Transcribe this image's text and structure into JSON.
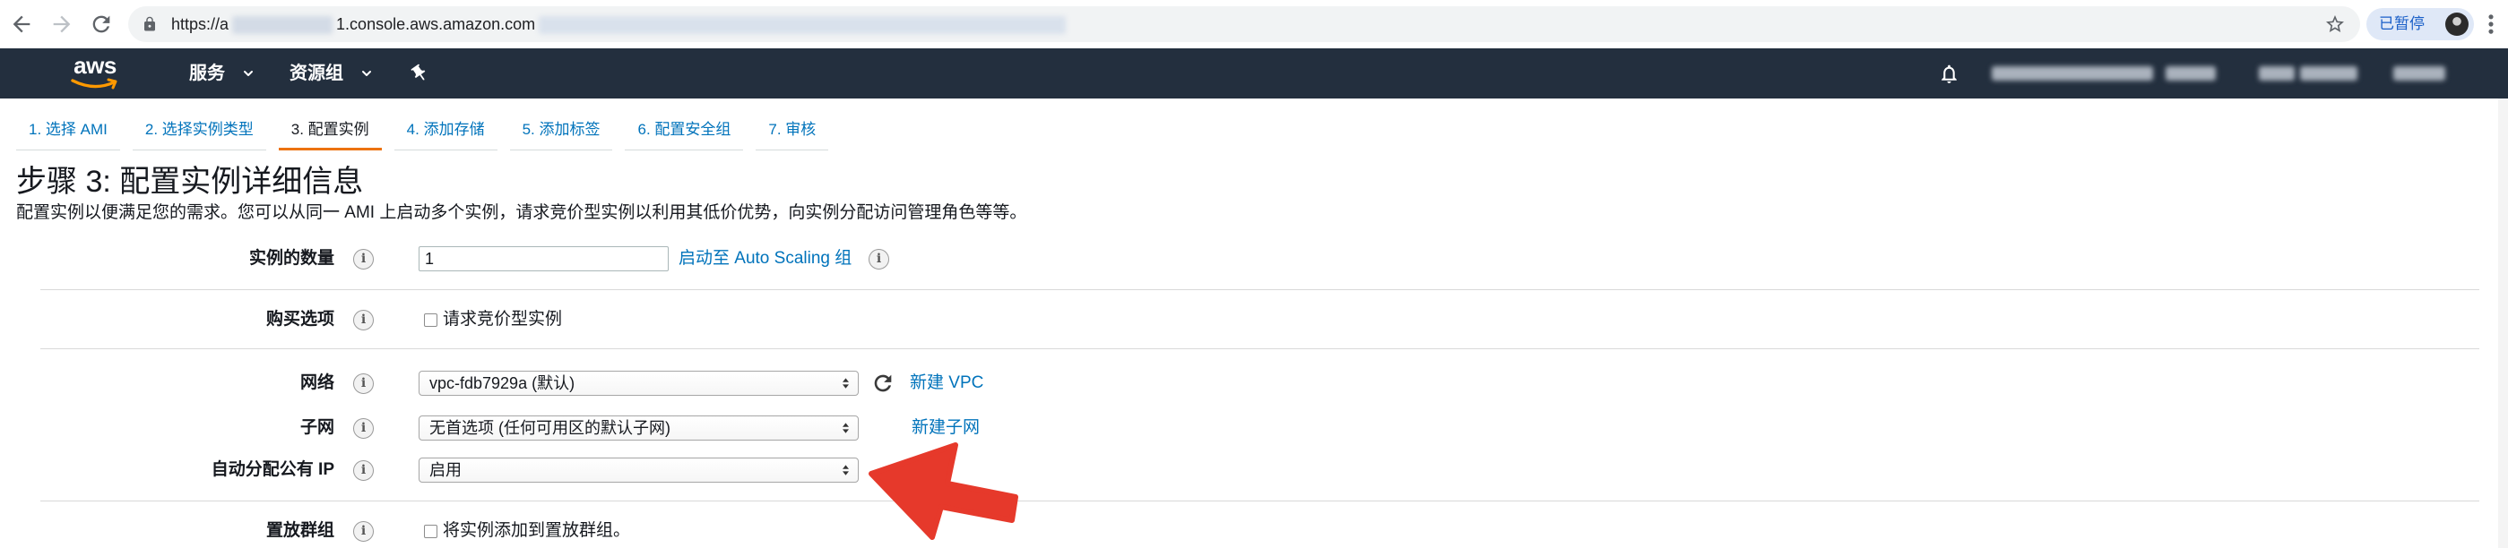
{
  "browser": {
    "url_start": "https://a",
    "url_host": "1.console.aws.amazon.com",
    "profile_status": "已暂停"
  },
  "top_nav": {
    "logo_text": "aws",
    "services_label": "服务",
    "resource_groups_label": "资源组"
  },
  "wizard": {
    "tabs": [
      {
        "label": "1. 选择 AMI",
        "active": false
      },
      {
        "label": "2. 选择实例类型",
        "active": false
      },
      {
        "label": "3. 配置实例",
        "active": true
      },
      {
        "label": "4. 添加存储",
        "active": false
      },
      {
        "label": "5. 添加标签",
        "active": false
      },
      {
        "label": "6. 配置安全组",
        "active": false
      },
      {
        "label": "7. 审核",
        "active": false
      }
    ]
  },
  "page": {
    "title": "步骤 3: 配置实例详细信息",
    "description": "配置实例以便满足您的需求。您可以从同一 AMI 上启动多个实例，请求竞价型实例以利用其低价优势，向实例分配访问管理角色等等。"
  },
  "form": {
    "instance_count": {
      "label": "实例的数量",
      "value": "1",
      "link": "启动至 Auto Scaling 组"
    },
    "purchase_option": {
      "label": "购买选项",
      "checkbox_label": "请求竞价型实例",
      "checked": false
    },
    "network": {
      "label": "网络",
      "selected": "vpc-fdb7929a (默认)",
      "link": "新建 VPC"
    },
    "subnet": {
      "label": "子网",
      "selected": "无首选项 (任何可用区的默认子网)",
      "link": "新建子网"
    },
    "auto_public_ip": {
      "label": "自动分配公有 IP",
      "selected": "启用"
    },
    "placement_group": {
      "label": "置放群组",
      "checkbox_label": "将实例添加到置放群组。",
      "checked": false
    }
  },
  "icons": {
    "back": "back-arrow-icon",
    "forward": "forward-arrow-icon",
    "reload": "reload-icon",
    "lock": "lock-icon",
    "bookmark": "star-icon",
    "menu": "more-vert-icon",
    "dropdown": "chevron-down-icon",
    "pin": "pin-icon",
    "notifications": "bell-icon",
    "info": "info-icon",
    "refresh": "refresh-icon",
    "annotation": "red-arrow-icon"
  },
  "colors": {
    "nav_background": "#232f3e",
    "accent": "#ec7211",
    "link": "#0073bb",
    "annotation_arrow": "#e6392b"
  }
}
